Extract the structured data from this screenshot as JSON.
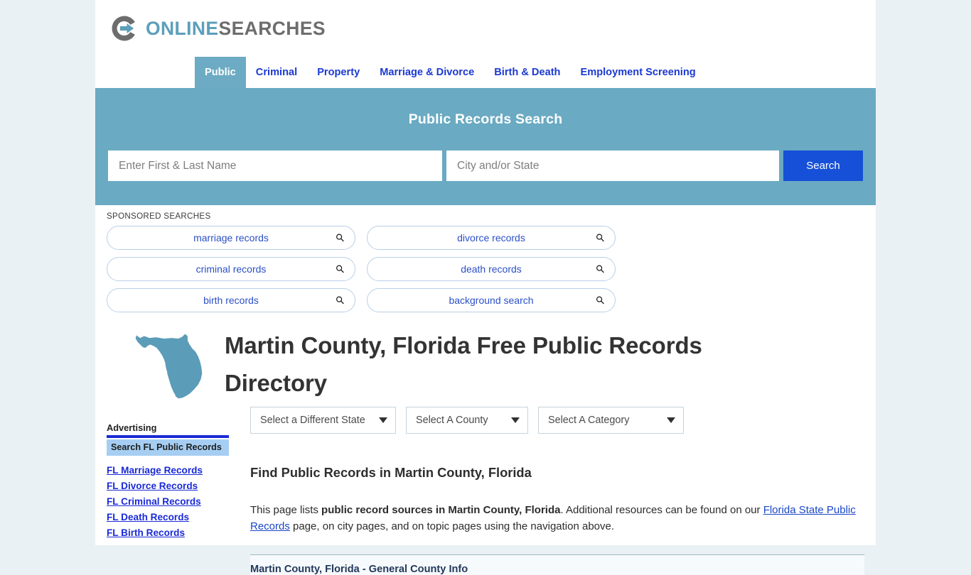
{
  "brand": {
    "name_part1": "ONLINE",
    "name_part2": "SEARCHES",
    "accent_color": "#5c9fba",
    "gray_color": "#6d6d6d"
  },
  "nav": {
    "items": [
      {
        "label": "Public",
        "active": true
      },
      {
        "label": "Criminal",
        "active": false
      },
      {
        "label": "Property",
        "active": false
      },
      {
        "label": "Marriage & Divorce",
        "active": false
      },
      {
        "label": "Birth & Death",
        "active": false
      },
      {
        "label": "Employment Screening",
        "active": false
      }
    ]
  },
  "search": {
    "title": "Public Records Search",
    "name_placeholder": "Enter First & Last Name",
    "name_value": "",
    "city_placeholder": "City and/or State",
    "city_value": "",
    "button_label": "Search",
    "band_color": "#6aaac2",
    "button_color": "#1650d8"
  },
  "sponsored": {
    "label": "SPONSORED SEARCHES",
    "pills": [
      {
        "label": "marriage records"
      },
      {
        "label": "divorce records"
      },
      {
        "label": "criminal records"
      },
      {
        "label": "death records"
      },
      {
        "label": "birth records"
      },
      {
        "label": "background search"
      }
    ]
  },
  "hero": {
    "title": "Martin County, Florida Free Public Records Directory",
    "map_alt": "florida-state-map",
    "map_color": "#5b9cb8"
  },
  "selectors": [
    {
      "label": "Select a Different State"
    },
    {
      "label": "Select A County"
    },
    {
      "label": "Select A Category"
    }
  ],
  "sidebar": {
    "heading": "Advertising",
    "banner_label": "Search FL Public Records",
    "links": [
      {
        "label": "FL Marriage Records"
      },
      {
        "label": "FL Divorce Records"
      },
      {
        "label": "FL Criminal Records"
      },
      {
        "label": "FL Death Records"
      },
      {
        "label": "FL Birth Records"
      }
    ]
  },
  "content": {
    "section_heading": "Find Public Records in Martin County, Florida",
    "paragraph": {
      "text_1": "This page lists ",
      "bold_1": "public record sources in Martin County, Florida",
      "text_2": ". Additional resources can be found on our ",
      "link_1": "Florida State Public Records",
      "text_3": " page, on city pages, and on topic pages using the navigation above."
    },
    "table_title": "Martin County, Florida - General County Info"
  }
}
